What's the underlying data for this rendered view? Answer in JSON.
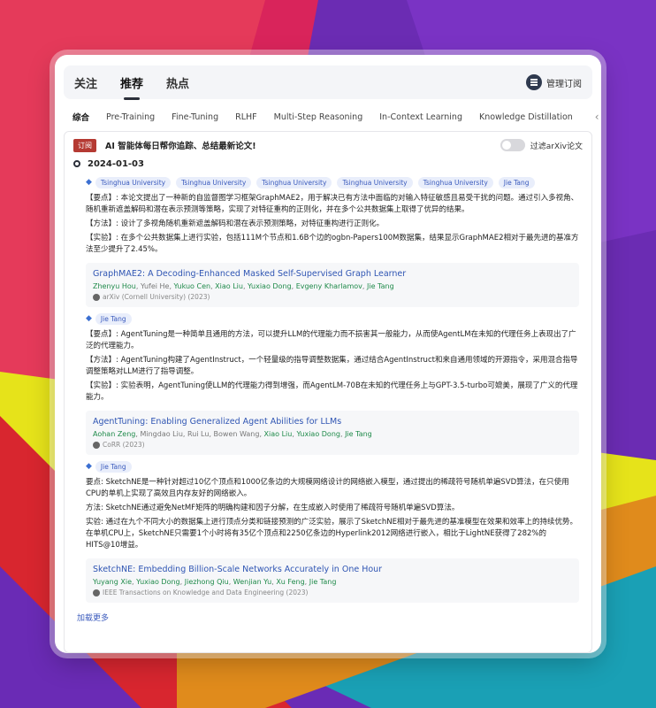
{
  "tabs": [
    "关注",
    "推荐",
    "热点"
  ],
  "active_tab": "推荐",
  "manage_label": "管理订阅",
  "categories": [
    "综合",
    "Pre-Training",
    "Fine-Tuning",
    "RLHF",
    "Multi-Step Reasoning",
    "In-Context Learning",
    "Knowledge Distillation"
  ],
  "nav_prev": "‹",
  "nav_next": "›",
  "subscribe_badge": "订阅",
  "subscribe_text": "AI 智能体每日帮你追踪、总结最新论文!",
  "filter_label": "过滤arXiv论文",
  "date": "2024-01-03",
  "items": [
    {
      "tags": [
        "Tsinghua University",
        "Tsinghua University",
        "Tsinghua University",
        "Tsinghua University",
        "Tsinghua University",
        "Jie Tang"
      ],
      "paragraphs": [
        "【要点】: 本论文提出了一种新的自监督图学习框架GraphMAE2，用于解决已有方法中面临的对输入特征敏感且易受干扰的问题。通过引入多视角、随机重新遮盖解码和潜在表示预测等策略，实现了对特征重构的正则化，并在多个公共数据集上取得了优异的结果。",
        "【方法】: 设计了多视角随机重新遮盖解码和潜在表示预测策略，对特征重构进行正则化。",
        "【实验】: 在多个公共数据集上进行实验，包括111M个节点和1.6B个边的ogbn-Papers100M数据集，结果显示GraphMAE2相对于最先进的基准方法至少提升了2.45%。"
      ],
      "paper_title": "GraphMAE2: A Decoding-Enhanced Masked Self-Supervised Graph Learner",
      "authors": [
        {
          "name": "Zhenyu Hou",
          "hl": true
        },
        {
          "name": "Yufei He",
          "hl": false
        },
        {
          "name": "Yukuo Cen",
          "hl": true
        },
        {
          "name": "Xiao Liu",
          "hl": true
        },
        {
          "name": "Yuxiao Dong",
          "hl": true
        },
        {
          "name": "Evgeny Kharlamov",
          "hl": true
        },
        {
          "name": "Jie Tang",
          "hl": true
        }
      ],
      "venue": "arXiv (Cornell University) (2023)"
    },
    {
      "tags": [
        "Jie Tang"
      ],
      "paragraphs": [
        "【要点】: AgentTuning是一种简单且通用的方法，可以提升LLM的代理能力而不损害其一般能力，从而使AgentLM在未知的代理任务上表现出了广泛的代理能力。",
        "【方法】: AgentTuning构建了AgentInstruct，一个轻量级的指导调整数据集，通过结合AgentInstruct和来自通用领域的开源指令，采用混合指导调整策略对LLM进行了指导调整。",
        "【实验】: 实验表明，AgentTuning使LLM的代理能力得到增强，而AgentLM-70B在未知的代理任务上与GPT-3.5-turbo可媲美，展现了广义的代理能力。"
      ],
      "paper_title": "AgentTuning: Enabling Generalized Agent Abilities for LLMs",
      "authors": [
        {
          "name": "Aohan Zeng",
          "hl": true
        },
        {
          "name": "Mingdao Liu",
          "hl": false
        },
        {
          "name": "Rui Lu",
          "hl": false
        },
        {
          "name": "Bowen Wang",
          "hl": false
        },
        {
          "name": "Xiao Liu",
          "hl": true
        },
        {
          "name": "Yuxiao Dong",
          "hl": true
        },
        {
          "name": "Jie Tang",
          "hl": true
        }
      ],
      "venue": "CoRR (2023)"
    },
    {
      "tags": [
        "Jie Tang"
      ],
      "paragraphs": [
        "要点: SketchNE是一种针对超过10亿个顶点和1000亿条边的大规模网络设计的网络嵌入模型，通过提出的稀疏符号随机单遍SVD算法，在只使用CPU的单机上实现了高效且内存友好的网络嵌入。",
        "方法: SketchNE通过避免NetMF矩阵的明确构建和因子分解，在生成嵌入时使用了稀疏符号随机单遍SVD算法。",
        "实验: 通过在九个不同大小的数据集上进行顶点分类和链接预测的广泛实验，展示了SketchNE相对于最先进的基准模型在效果和效率上的持续优势。在单机CPU上，SketchNE只需要1个小时将有35亿个顶点和2250亿条边的Hyperlink2012网络进行嵌入，相比于LightNE获得了282%的HITS@10增益。"
      ],
      "paper_title": "SketchNE: Embedding Billion-Scale Networks Accurately in One Hour",
      "authors": [
        {
          "name": "Yuyang Xie",
          "hl": true
        },
        {
          "name": "Yuxiao Dong",
          "hl": true
        },
        {
          "name": "Jiezhong Qiu",
          "hl": true
        },
        {
          "name": "Wenjian Yu",
          "hl": true
        },
        {
          "name": "Xu Feng",
          "hl": true
        },
        {
          "name": "Jie Tang",
          "hl": true
        }
      ],
      "venue": "IEEE Transactions on Knowledge and Data Engineering (2023)"
    }
  ],
  "load_more": "加载更多"
}
